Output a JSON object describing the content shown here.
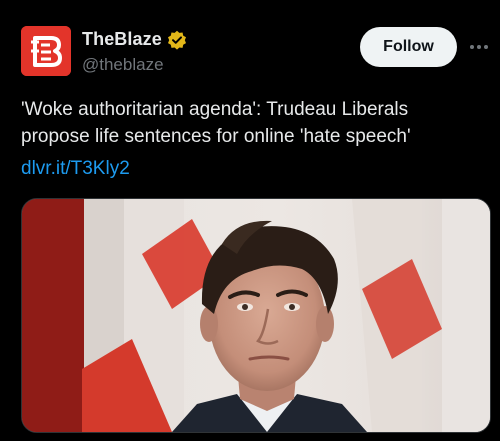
{
  "author": {
    "name": "TheBlaze",
    "handle": "@theblaze",
    "avatar_icon": "theblaze-logo-icon",
    "verified_icon": "verified-gold-badge-icon"
  },
  "follow_button": {
    "label": "Follow"
  },
  "more_menu": {
    "icon": "more-horizontal-icon"
  },
  "post": {
    "text": "'Woke authoritarian agenda': Trudeau Liberals propose life sentences for online 'hate speech'",
    "link_text": "dlvr.it/T3Kly2"
  },
  "media": {
    "icon": "news-photo-image"
  },
  "colors": {
    "background": "#000000",
    "text_primary": "#e7e9ea",
    "text_secondary": "#71767b",
    "link": "#1d9bf0",
    "follow_bg": "#eff3f4",
    "brand_red": "#e3342a",
    "verified_gold": "#e2b719"
  }
}
